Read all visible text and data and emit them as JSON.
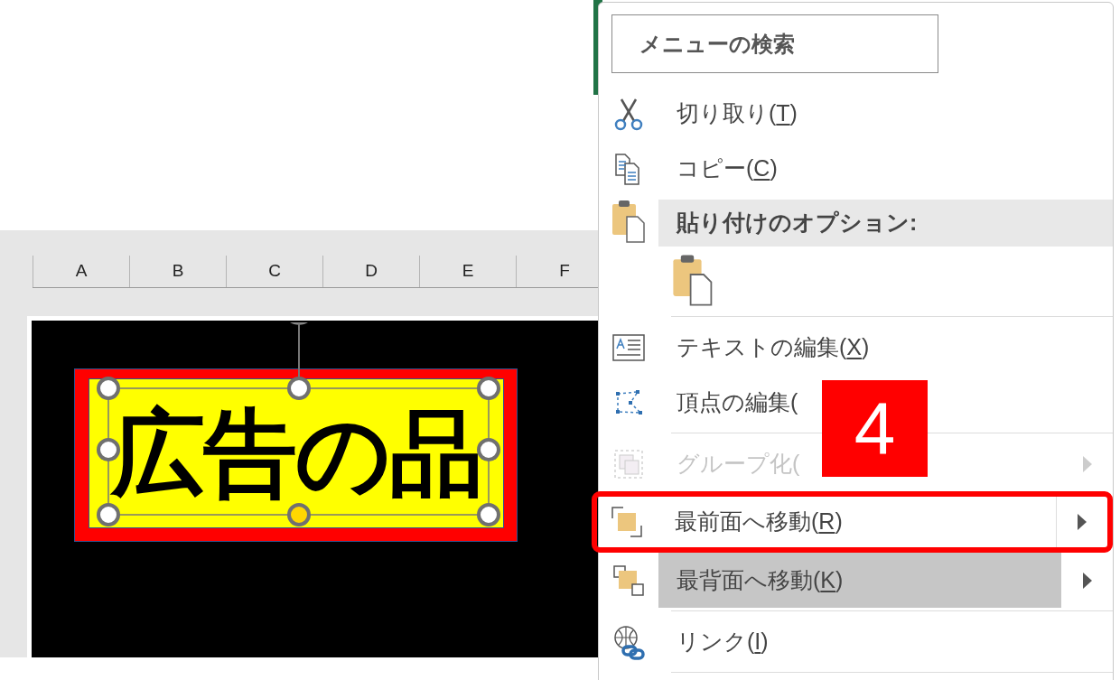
{
  "sheet": {
    "columns": [
      "A",
      "B",
      "C",
      "D",
      "E",
      "F"
    ],
    "shape": {
      "text": "広告の品",
      "selected": true
    }
  },
  "context_menu": {
    "search": {
      "placeholder": "メニューの検索"
    },
    "items": [
      {
        "kind": "command",
        "label": "切り取り(",
        "key": "T",
        "end": ")",
        "selected": false,
        "disabled": false,
        "submenu": false,
        "outlined": false
      },
      {
        "kind": "command",
        "label": "コピー(",
        "key": "C",
        "end": ")",
        "selected": false,
        "disabled": false,
        "submenu": false,
        "outlined": false
      },
      {
        "kind": "header",
        "label": "貼り付けのオプション:"
      },
      {
        "kind": "paste_option"
      },
      {
        "kind": "separator"
      },
      {
        "kind": "command",
        "label": "テキストの編集(",
        "key": "X",
        "end": ")",
        "selected": false,
        "disabled": false,
        "submenu": false,
        "outlined": false
      },
      {
        "kind": "command",
        "label": "頂点の編集(",
        "selected": false,
        "disabled": false,
        "submenu": false,
        "outlined": false
      },
      {
        "kind": "separator"
      },
      {
        "kind": "command",
        "label": "グループ化(",
        "selected": false,
        "disabled": true,
        "submenu": true,
        "outlined": false
      },
      {
        "kind": "command",
        "label": "最前面へ移動(",
        "key": "R",
        "end": ")",
        "selected": false,
        "disabled": false,
        "submenu": true,
        "outlined": true
      },
      {
        "kind": "command",
        "label": "最背面へ移動(",
        "key": "K",
        "end": ")",
        "selected": true,
        "disabled": false,
        "submenu": true,
        "outlined": false
      },
      {
        "kind": "separator"
      },
      {
        "kind": "command",
        "label": "リンク(",
        "key": "I",
        "end": ")",
        "selected": false,
        "disabled": false,
        "submenu": false,
        "outlined": false
      },
      {
        "kind": "separator"
      }
    ]
  },
  "annotation": {
    "step": "4"
  }
}
